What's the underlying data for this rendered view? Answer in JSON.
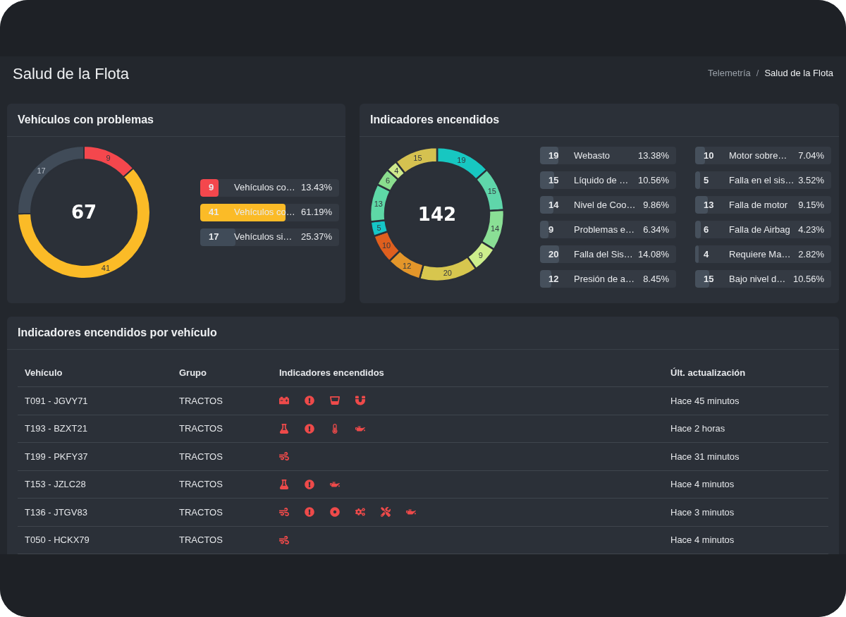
{
  "header": {
    "title": "Salud de la Flota",
    "breadcrumb_separator": "/",
    "breadcrumb": [
      {
        "label": "Telemetría",
        "selected": false
      },
      {
        "label": "Salud de la Flota",
        "selected": true
      }
    ]
  },
  "problems_card": {
    "title": "Vehículos con problemas",
    "total": "67",
    "chart_data": {
      "type": "donut",
      "categories": [
        "Vehículos co…",
        "Vehículos co…",
        "Vehículos si…"
      ],
      "values": [
        9,
        41,
        17
      ],
      "colors": [
        "#f4474d",
        "#fbbb27",
        "#404b58"
      ],
      "data_labels": true
    },
    "legend": [
      {
        "count": "9",
        "percent": "13.43%",
        "level": 0.1343,
        "color": "#f4474d"
      },
      {
        "count": "41",
        "percent": "61.19%",
        "level": 0.6119,
        "color": "#fbbb27"
      },
      {
        "count": "17",
        "percent": "25.37%",
        "level": 0.2537,
        "color": "#404b58"
      }
    ]
  },
  "indicators_card": {
    "title": "Indicadores encendidos",
    "total": "142",
    "chart_data": {
      "type": "donut",
      "categories": [
        "Webasto",
        "Líquido de …",
        "Nivel de Coo…",
        "Problemas e…",
        "Falla del Sis…",
        "Presión de a…",
        "Motor sobre…",
        "Falla en el sis…",
        "Falla de motor",
        "Falla de Airbag",
        "Requiere Ma…",
        "Bajo nivel d…"
      ],
      "values": [
        19,
        15,
        14,
        9,
        20,
        12,
        10,
        5,
        13,
        6,
        4,
        15
      ],
      "colors": [
        "#17c7c1",
        "#5fd6aa",
        "#8adf95",
        "#cdee8c",
        "#d7c64e",
        "#e3962a",
        "#df5f1e",
        "#15c6c8",
        "#5ed8a6",
        "#8add8e",
        "#cfe98c",
        "#d5c150"
      ],
      "data_labels": true
    },
    "legend": [
      {
        "count": "19",
        "percent": "13.38%",
        "level": 0.1338
      },
      {
        "count": "15",
        "percent": "10.56%",
        "level": 0.1056
      },
      {
        "count": "14",
        "percent": "9.86%",
        "level": 0.0986
      },
      {
        "count": "9",
        "percent": "6.34%",
        "level": 0.0634
      },
      {
        "count": "20",
        "percent": "14.08%",
        "level": 0.1408
      },
      {
        "count": "12",
        "percent": "8.45%",
        "level": 0.0845
      },
      {
        "count": "10",
        "percent": "7.04%",
        "level": 0.0704
      },
      {
        "count": "5",
        "percent": "3.52%",
        "level": 0.0352
      },
      {
        "count": "13",
        "percent": "9.15%",
        "level": 0.0915
      },
      {
        "count": "6",
        "percent": "4.23%",
        "level": 0.0423
      },
      {
        "count": "4",
        "percent": "2.82%",
        "level": 0.0282
      },
      {
        "count": "15",
        "percent": "10.56%",
        "level": 0.1056
      }
    ]
  },
  "vehicles_table": {
    "title": "Indicadores encendidos por vehículo",
    "columns": [
      "Vehículo",
      "Grupo",
      "Indicadores encendidos",
      "Últ. actualización"
    ],
    "rows": [
      {
        "vehicle": "T091 - JGVY71",
        "group": "TRACTOS",
        "indicators": [
          {
            "kind": "battery"
          },
          {
            "kind": "alert"
          },
          {
            "kind": "tank"
          },
          {
            "kind": "horseshoe"
          }
        ],
        "updated": "Hace 45 minutos"
      },
      {
        "vehicle": "T193 - BZXT21",
        "group": "TRACTOS",
        "indicators": [
          {
            "kind": "flask"
          },
          {
            "kind": "alert"
          },
          {
            "kind": "thermometer"
          },
          {
            "kind": "oil"
          }
        ],
        "updated": "Hace 2 horas"
      },
      {
        "vehicle": "T199 - PKFY37",
        "group": "TRACTOS",
        "indicators": [
          {
            "kind": "wind"
          }
        ],
        "updated": "Hace 31 minutos"
      },
      {
        "vehicle": "T153 - JZLC28",
        "group": "TRACTOS",
        "indicators": [
          {
            "kind": "flask"
          },
          {
            "kind": "alert"
          },
          {
            "kind": "oil"
          }
        ],
        "updated": "Hace 4 minutos"
      },
      {
        "vehicle": "T136 - JTGV83",
        "group": "TRACTOS",
        "indicators": [
          {
            "kind": "wind"
          },
          {
            "kind": "alert"
          },
          {
            "kind": "disc"
          },
          {
            "kind": "gears"
          },
          {
            "kind": "tools"
          },
          {
            "kind": "oil"
          }
        ],
        "updated": "Hace 3 minutos"
      },
      {
        "vehicle": "T050 - HCKX79",
        "group": "TRACTOS",
        "indicators": [
          {
            "kind": "wind"
          }
        ],
        "updated": "Hace 4 minutos"
      }
    ]
  }
}
